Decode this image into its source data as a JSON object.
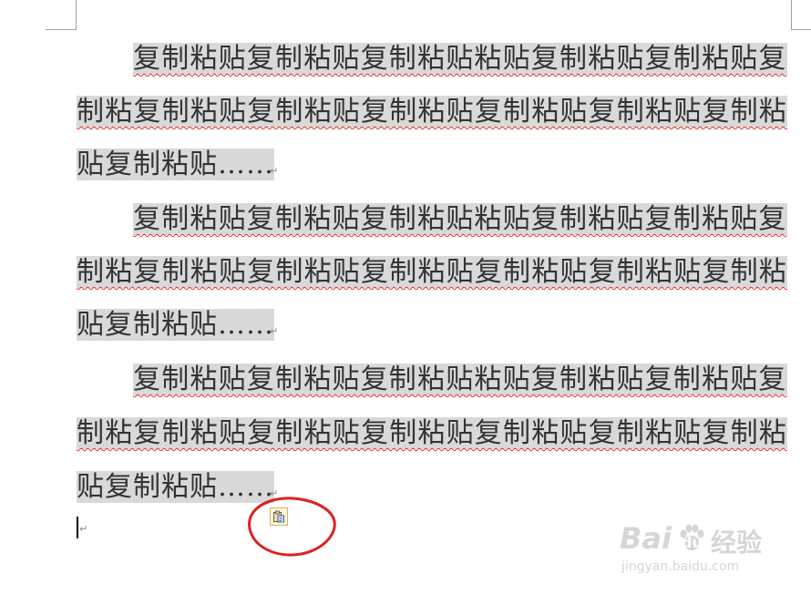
{
  "document": {
    "paragraphs": [
      {
        "lines": [
          "复制粘贴复制粘贴复制粘贴粘贴复制粘贴复制粘贴复",
          "制粘复制粘贴复制粘贴复制粘贴复制粘贴复制粘贴复制粘",
          "贴复制粘贴……"
        ]
      },
      {
        "lines": [
          "复制粘贴复制粘贴复制粘贴粘贴复制粘贴复制粘贴复",
          "制粘复制粘贴复制粘贴复制粘贴复制粘贴复制粘贴复制粘",
          "贴复制粘贴……"
        ]
      },
      {
        "lines": [
          "复制粘贴复制粘贴复制粘贴粘贴复制粘贴复制粘贴复",
          "制粘复制粘贴复制粘贴复制粘贴复制粘贴复制粘贴复制粘",
          "贴复制粘贴……"
        ]
      }
    ],
    "paragraph_mark": "↵",
    "selection_color": "#d9d9d9",
    "spellcheck_underline_color": "#e03030"
  },
  "paste_options": {
    "icon": "clipboard-paste-icon",
    "highlight_color": "#e02020"
  },
  "watermark": {
    "logo_text": "Bai",
    "logo_paw": "du",
    "site_name": "经验",
    "url": "jingyan.baidu.com"
  }
}
